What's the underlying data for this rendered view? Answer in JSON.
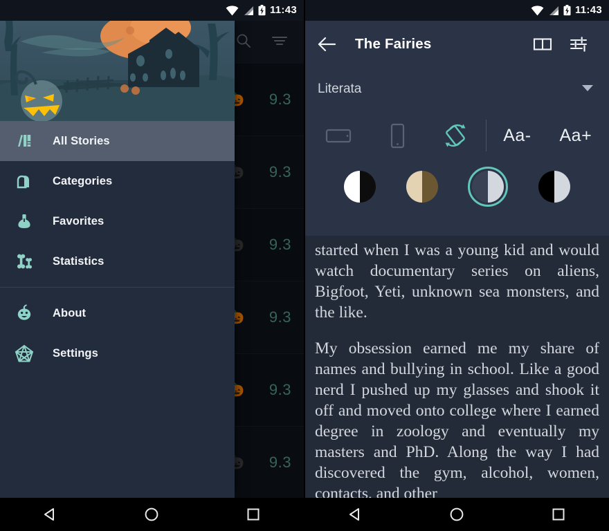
{
  "status_bar": {
    "time": "11:43",
    "icons": [
      "wifi-icon",
      "signal-icon",
      "battery-charging-icon"
    ]
  },
  "left_screen": {
    "app_bar": {
      "search_label": "search-icon",
      "sort_label": "sort-icon"
    },
    "story_list": {
      "rating_value": "9.3",
      "rows": [
        {
          "rating": "9.3",
          "pumpkin": "🎃",
          "dim": false
        },
        {
          "rating": "9.3",
          "pumpkin": "🎃",
          "dim": true
        },
        {
          "rating": "9.3",
          "pumpkin": "🎃",
          "dim": true
        },
        {
          "rating": "9.3",
          "pumpkin": "🎃",
          "dim": false
        },
        {
          "rating": "9.3",
          "pumpkin": "🎃",
          "dim": false
        },
        {
          "rating": "9.3",
          "pumpkin": "🎃",
          "dim": true
        }
      ]
    },
    "drawer": {
      "header_image_alt": "halloween-haunted-house-banner",
      "items": [
        {
          "label": "All Stories",
          "icon": "books-icon",
          "selected": true
        },
        {
          "label": "Categories",
          "icon": "tombstone-icon",
          "selected": false
        },
        {
          "label": "Favorites",
          "icon": "potion-icon",
          "selected": false
        },
        {
          "label": "Statistics",
          "icon": "bone-icon",
          "selected": false
        }
      ],
      "secondary_items": [
        {
          "label": "About",
          "icon": "pumpkin-icon",
          "selected": false
        },
        {
          "label": "Settings",
          "icon": "pentagram-icon",
          "selected": false
        }
      ]
    }
  },
  "right_screen": {
    "app_bar": {
      "back_label": "back-arrow-icon",
      "title": "The Fairies",
      "book_icon": "open-book-icon",
      "settings_icon": "reader-settings-icon"
    },
    "font_select": {
      "value": "Literata",
      "caret": "chevron-down-icon"
    },
    "tools": [
      {
        "name": "landscape-mode-icon",
        "label": ""
      },
      {
        "name": "portrait-mode-icon",
        "label": ""
      },
      {
        "name": "auto-rotate-icon",
        "label": ""
      }
    ],
    "text_size": {
      "decrease": "Aa-",
      "increase": "Aa+"
    },
    "themes": [
      {
        "name": "theme-light",
        "left": "#ffffff",
        "right": "#0d0d0d",
        "selected": false
      },
      {
        "name": "theme-sepia",
        "left": "#e4d3b2",
        "right": "#6b5731",
        "selected": false
      },
      {
        "name": "theme-dark",
        "left": "#394254",
        "right": "#d3d7de",
        "selected": true
      },
      {
        "name": "theme-black",
        "left": "#000000",
        "right": "#d3d7de",
        "selected": false
      }
    ],
    "content": {
      "paragraphs": [
        "started when I was a young kid and would watch documentary series on aliens, Bigfoot, Yeti, unknown sea monsters, and the like.",
        "My obsession earned me my share of names and bullying in school. Like a good nerd I pushed up my glasses and shook it off and moved onto college where I earned degree in zoology and eventually my masters and PhD. Along the way I had discovered the gym, alcohol, women, contacts, and other"
      ]
    }
  },
  "nav_bar": {
    "back": "back-triangle-icon",
    "home": "home-circle-icon",
    "recents": "recents-square-icon"
  },
  "colors": {
    "accent": "#63c6bb",
    "drawer_bg": "#232c3d",
    "reader_bg": "#242b38",
    "chrome_bg": "#2b3446",
    "rating": "#4e8e82"
  }
}
